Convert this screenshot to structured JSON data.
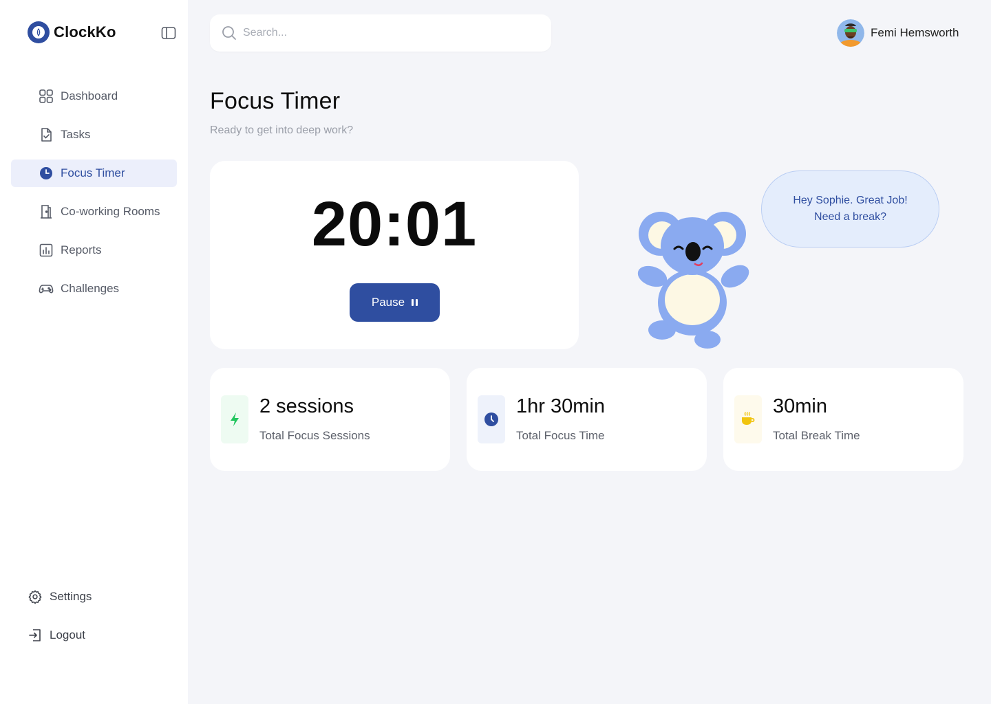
{
  "app": {
    "name": "ClockKo",
    "brand_color": "#2f4ea0"
  },
  "sidebar": {
    "items": [
      {
        "label": "Dashboard",
        "icon": "grid-icon",
        "active": false
      },
      {
        "label": "Tasks",
        "icon": "document-check-icon",
        "active": false
      },
      {
        "label": "Focus Timer",
        "icon": "clock-icon",
        "active": true
      },
      {
        "label": "Co-working Rooms",
        "icon": "door-icon",
        "active": false
      },
      {
        "label": "Reports",
        "icon": "bar-chart-icon",
        "active": false
      },
      {
        "label": "Challenges",
        "icon": "gamepad-icon",
        "active": false
      }
    ],
    "bottom": [
      {
        "label": "Settings",
        "icon": "gear-icon"
      },
      {
        "label": "Logout",
        "icon": "logout-icon"
      }
    ]
  },
  "search": {
    "placeholder": "Search..."
  },
  "user": {
    "name": "Femi Hemsworth"
  },
  "page": {
    "title": "Focus Timer",
    "subtitle": "Ready to get into deep work?"
  },
  "timer": {
    "value": "20:01",
    "pause_label": "Pause"
  },
  "bubble": {
    "line1": "Hey Sophie. Great Job!",
    "line2": "Need a break?"
  },
  "stats": [
    {
      "value": "2 sessions",
      "label": "Total Focus Sessions",
      "icon": "lightning-icon",
      "color": "#22c55e"
    },
    {
      "value": "1hr 30min",
      "label": "Total Focus Time",
      "icon": "clock-icon",
      "color": "#2f4ea0"
    },
    {
      "value": "30min",
      "label": "Total Break Time",
      "icon": "coffee-cup-icon",
      "color": "#f1c40f"
    }
  ]
}
